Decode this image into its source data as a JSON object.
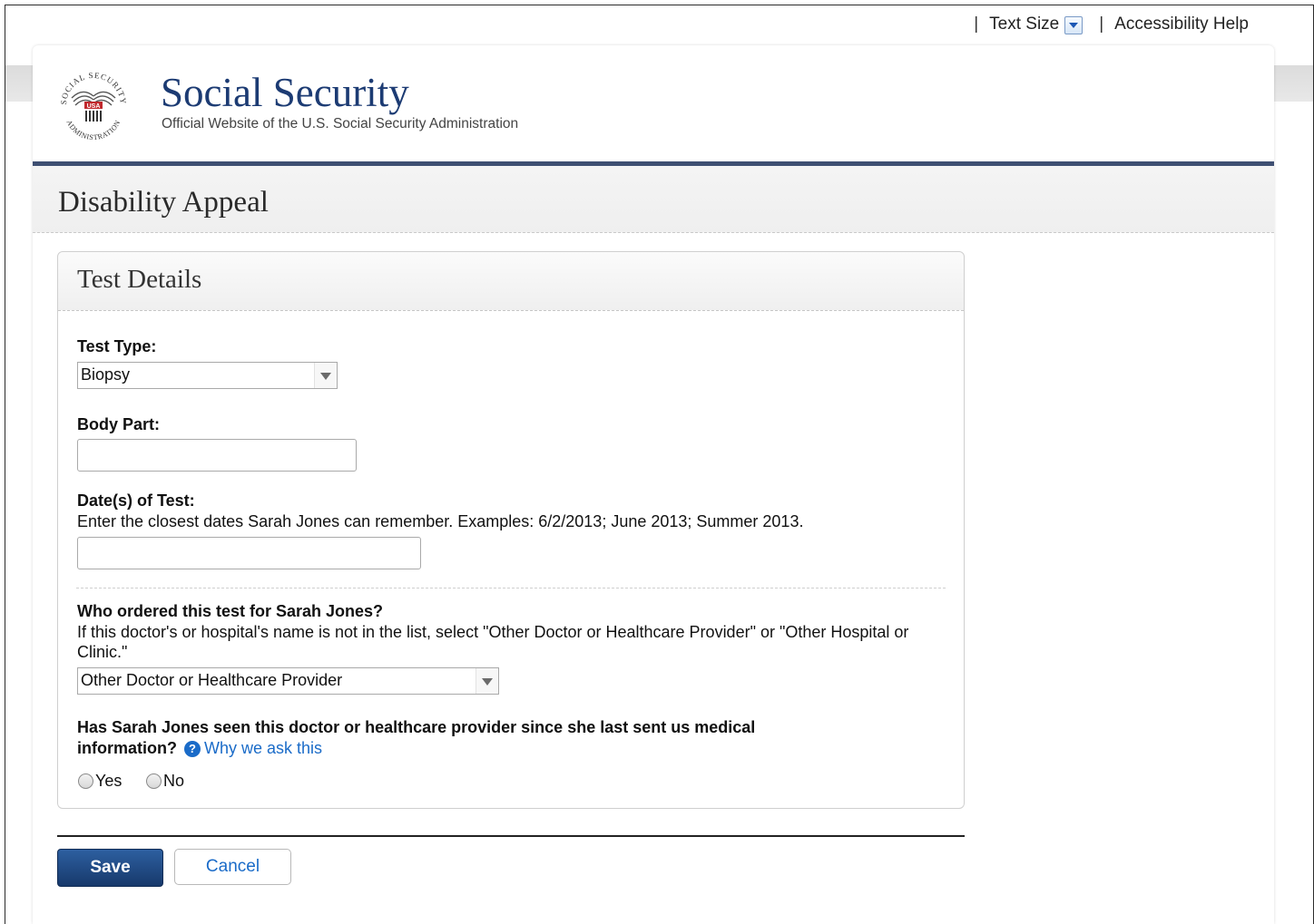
{
  "utility_bar": {
    "separator": "|",
    "text_size_label": "Text Size",
    "accessibility_label": "Accessibility Help"
  },
  "brand": {
    "title": "Social Security",
    "subtitle": "Official Website of the U.S. Social Security Administration",
    "seal_text_top": "SOCIAL SECURITY",
    "seal_text_bottom": "ADMINISTRATION",
    "seal_usa": "USA"
  },
  "page": {
    "title": "Disability Appeal"
  },
  "panel": {
    "title": "Test Details",
    "test_type": {
      "label": "Test Type:",
      "value": "Biopsy"
    },
    "body_part": {
      "label": "Body Part:",
      "value": ""
    },
    "dates": {
      "label": "Date(s) of Test:",
      "hint": "Enter the closest dates Sarah Jones can remember. Examples: 6/2/2013; June 2013; Summer 2013.",
      "value": ""
    },
    "ordered_by": {
      "label": "Who ordered this test for Sarah Jones?",
      "hint": "If this doctor's or hospital's name is not in the list, select \"Other Doctor or Healthcare Provider\" or \"Other Hospital or Clinic.\"",
      "value": "Other Doctor or Healthcare Provider"
    },
    "seen_since": {
      "label_line1": "Has Sarah Jones seen this doctor or healthcare provider since she last sent us medical",
      "label_line2": "information?",
      "help_link": "Why we ask this",
      "options": [
        "Yes",
        "No"
      ]
    }
  },
  "actions": {
    "save": "Save",
    "cancel": "Cancel"
  },
  "colors": {
    "brand_blue": "#1c3b73",
    "link_blue": "#1a6bc8",
    "save_bg": "#1f4a84"
  }
}
